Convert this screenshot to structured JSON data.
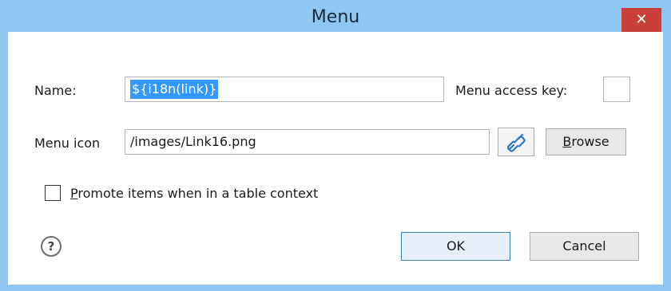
{
  "window": {
    "title": "Menu",
    "close_glyph": "✕"
  },
  "form": {
    "name_label": "Name:",
    "name_value": "${i18n(link)}",
    "access_key_label": "Menu access key:",
    "access_key_value": "",
    "icon_label": "Menu icon",
    "icon_value": "/images/Link16.png",
    "link_icon": "chain-link-icon",
    "browse_prefix": "",
    "browse_mnemonic": "B",
    "browse_rest": "rowse",
    "promote_mnemonic": "P",
    "promote_rest": "romote items when in a table context",
    "promote_checked": false
  },
  "footer": {
    "help_glyph": "?",
    "ok_label": "OK",
    "cancel_label": "Cancel"
  },
  "colors": {
    "titlebar": "#8fc7f2",
    "close_button": "#c9403a",
    "selection": "#3399ff",
    "default_button_border": "#3c7fb1"
  }
}
